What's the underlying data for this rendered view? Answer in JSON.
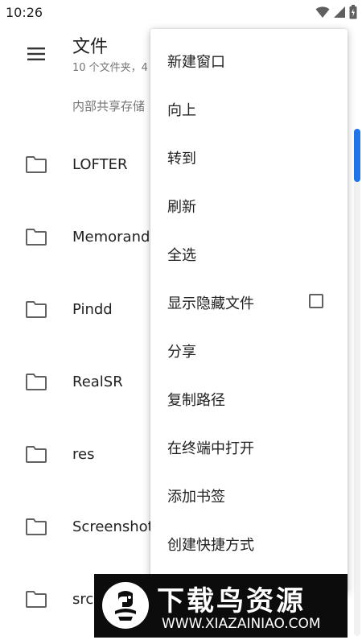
{
  "status": {
    "time": "10:26"
  },
  "header": {
    "title": "文件",
    "subtitle": "10 个文件夹，4",
    "location": "内部共享存储"
  },
  "files": [
    {
      "name": "LOFTER"
    },
    {
      "name": "Memorandum"
    },
    {
      "name": "Pindd"
    },
    {
      "name": "RealSR"
    },
    {
      "name": "res"
    },
    {
      "name": "Screenshots"
    },
    {
      "name": "src"
    }
  ],
  "menu": {
    "items": [
      {
        "label": "新建窗口"
      },
      {
        "label": "向上"
      },
      {
        "label": "转到"
      },
      {
        "label": "刷新"
      },
      {
        "label": "全选"
      },
      {
        "label": "显示隐藏文件",
        "checked": false
      },
      {
        "label": "分享"
      },
      {
        "label": "复制路径"
      },
      {
        "label": "在终端中打开"
      },
      {
        "label": "添加书签"
      },
      {
        "label": "创建快捷方式"
      }
    ]
  },
  "watermark": {
    "title": "下载鸟资源",
    "url": "WWW.XIAZAINIAO.COM"
  },
  "colors": {
    "accent": "#1e74e8",
    "banner_bg": "#0c0c0c"
  },
  "icons": {
    "nav": "menu-icon",
    "folder": "folder-icon"
  }
}
